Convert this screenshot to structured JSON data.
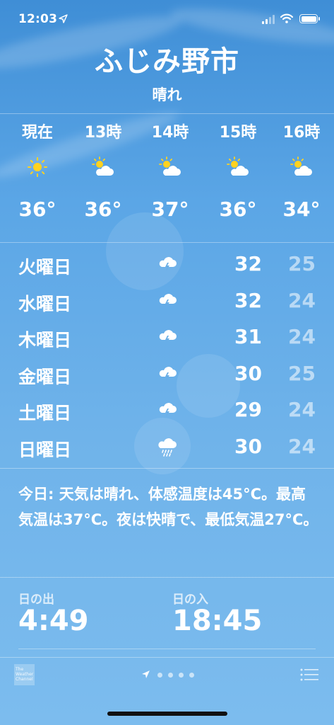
{
  "status_bar": {
    "time": "12:03"
  },
  "location": {
    "city": "ふじみ野市",
    "condition": "晴れ"
  },
  "hourly": [
    {
      "label": "現在",
      "icon": "sun-icon",
      "temp": "36°"
    },
    {
      "label": "13時",
      "icon": "partly-cloudy-icon",
      "temp": "36°"
    },
    {
      "label": "14時",
      "icon": "partly-cloudy-icon",
      "temp": "37°"
    },
    {
      "label": "15時",
      "icon": "partly-cloudy-icon",
      "temp": "36°"
    },
    {
      "label": "16時",
      "icon": "partly-cloudy-icon",
      "temp": "34°"
    }
  ],
  "daily": [
    {
      "day": "火曜日",
      "icon": "thunderstorm-icon",
      "high": "32",
      "low": "25"
    },
    {
      "day": "水曜日",
      "icon": "thunderstorm-icon",
      "high": "32",
      "low": "24"
    },
    {
      "day": "木曜日",
      "icon": "thunderstorm-icon",
      "high": "31",
      "low": "24"
    },
    {
      "day": "金曜日",
      "icon": "thunderstorm-icon",
      "high": "30",
      "low": "25"
    },
    {
      "day": "土曜日",
      "icon": "thunderstorm-icon",
      "high": "29",
      "low": "24"
    },
    {
      "day": "日曜日",
      "icon": "rain-icon",
      "high": "30",
      "low": "24"
    }
  ],
  "summary": "今日: 天気は晴れ、体感温度は45°C。最高気温は37°C。夜は快晴で、最低気温27°C。",
  "sun": {
    "sunrise_label": "日の出",
    "sunrise": "4:49",
    "sunset_label": "日の入",
    "sunset": "18:45"
  },
  "footer": {
    "logo_text": "The Weather Channel"
  }
}
